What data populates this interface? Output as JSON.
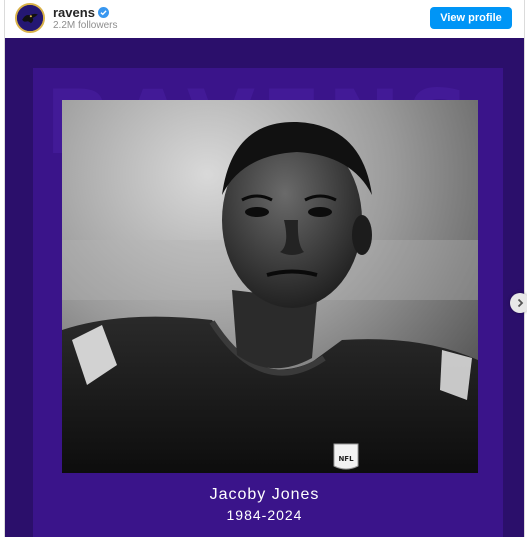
{
  "header": {
    "username": "ravens",
    "followers": "2.2M followers",
    "view_profile_label": "View profile",
    "avatar_icon": "ravens-logo-icon",
    "verified_icon": "verified-badge-icon"
  },
  "post": {
    "background_text": "RAVENS",
    "player_name": "Jacoby Jones",
    "years": "1984-2024",
    "jersey_badge": "NFL",
    "next_icon": "chevron-right-icon"
  },
  "colors": {
    "brand_purple": "#2b0f6b",
    "frame_purple": "#3a148a",
    "accent_blue": "#0095f6",
    "gold": "#d9b24a"
  }
}
